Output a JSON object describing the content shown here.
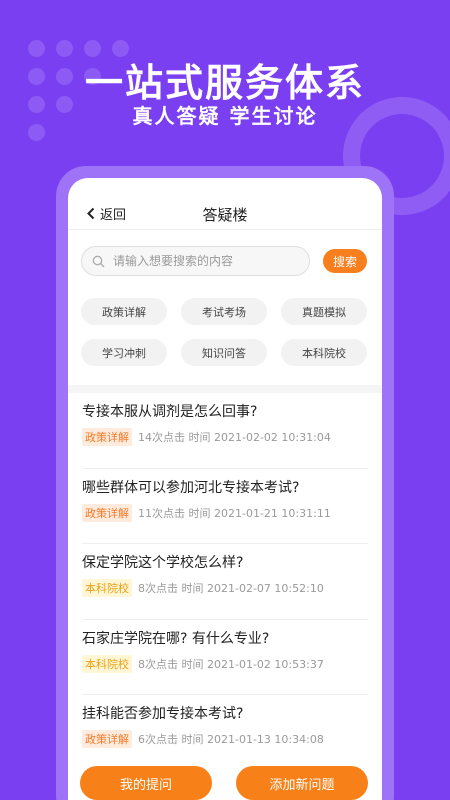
{
  "banner": {
    "headline": "一站式服务体系",
    "subline": "真人答疑  学生讨论"
  },
  "header": {
    "back_label": "返回",
    "title": "答疑楼"
  },
  "search": {
    "placeholder": "请输入想要搜索的内容",
    "value": "",
    "button_label": "搜索"
  },
  "categories": [
    "政策详解",
    "考试考场",
    "真题模拟",
    "学习冲刺",
    "知识问答",
    "本科院校"
  ],
  "questions": [
    {
      "title": "专接本服从调剂是怎么回事?",
      "tag": "政策详解",
      "clicks": "14次点击",
      "time": "时间 2021-02-02 10:31:04"
    },
    {
      "title": "哪些群体可以参加河北专接本考试?",
      "tag": "政策详解",
      "clicks": "11次点击",
      "time": "时间 2021-01-21 10:31:11"
    },
    {
      "title": "保定学院这个学校怎么样?",
      "tag": "本科院校",
      "clicks": "8次点击",
      "time": "时间 2021-02-07 10:52:10"
    },
    {
      "title": "石家庄学院在哪? 有什么专业?",
      "tag": "本科院校",
      "clicks": "8次点击",
      "time": "时间 2021-01-02 10:53:37"
    },
    {
      "title": "挂科能否参加专接本考试?",
      "tag": "政策详解",
      "clicks": "6次点击",
      "time": "时间 2021-01-13 10:34:08"
    }
  ],
  "footer": {
    "my_questions_label": "我的提问",
    "add_question_label": "添加新问题"
  },
  "colors": {
    "background": "#7B3FF2",
    "accent": "#F78018",
    "tag_policy": "#F47B2A",
    "tag_college": "#E8A317"
  }
}
